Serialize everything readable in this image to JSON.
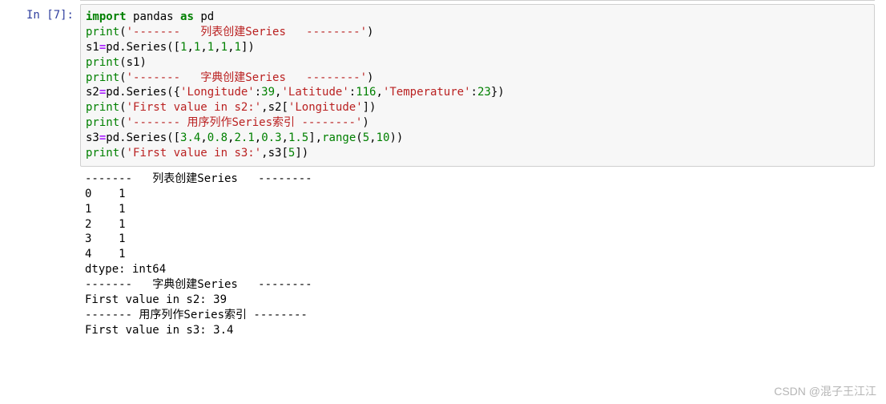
{
  "prompt": "In [7]:",
  "code": {
    "l1": {
      "import": "import",
      "pandas": "pandas",
      "as": "as",
      "pd": "pd"
    },
    "l2": {
      "print": "print",
      "str": "'-------   列表创建Series   --------'"
    },
    "l3": {
      "s1": "s1",
      "eq": "=",
      "pdSeries": "pd.Series",
      "vals": [
        "1",
        "1",
        "1",
        "1",
        "1"
      ]
    },
    "l4": {
      "print": "print",
      "arg": "s1"
    },
    "l5": {
      "print": "print",
      "str": "'-------   字典创建Series   --------'"
    },
    "l6": {
      "s2": "s2",
      "eq": "=",
      "pdSeries": "pd.Series",
      "k1": "'Longitude'",
      "v1": "39",
      "k2": "'Latitude'",
      "v2": "116",
      "k3": "'Temperature'",
      "v3": "23"
    },
    "l7": {
      "print": "print",
      "str": "'First value in s2:'",
      "s2": "s2",
      "key": "'Longitude'"
    },
    "l8": {
      "print": "print",
      "str": "'------- 用序列作Series索引 --------'"
    },
    "l9": {
      "s3": "s3",
      "eq": "=",
      "pdSeries": "pd.Series",
      "vals": [
        "3.4",
        "0.8",
        "2.1",
        "0.3",
        "1.5"
      ],
      "range": "range",
      "r1": "5",
      "r2": "10"
    },
    "l10": {
      "print": "print",
      "str": "'First value in s3:'",
      "s3": "s3",
      "idx": "5"
    }
  },
  "output": [
    "-------   列表创建Series   --------",
    "0    1",
    "1    1",
    "2    1",
    "3    1",
    "4    1",
    "dtype: int64",
    "-------   字典创建Series   --------",
    "First value in s2: 39",
    "------- 用序列作Series索引 --------",
    "First value in s3: 3.4"
  ],
  "watermark": "CSDN @混子王江江"
}
